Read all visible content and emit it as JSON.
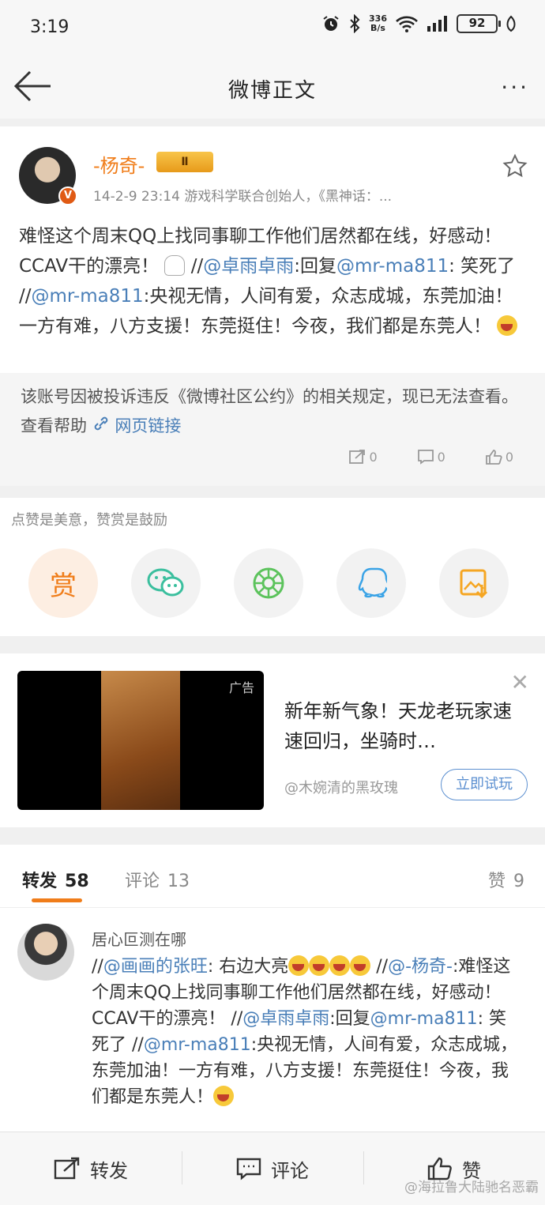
{
  "status_bar": {
    "time": "3:19",
    "net_speed_value": "336",
    "net_speed_unit": "B/s",
    "battery": "92"
  },
  "nav": {
    "title": "微博正文",
    "more": "···"
  },
  "post": {
    "username": "-杨奇-",
    "badge_level": "Ⅱ",
    "verified": "V",
    "time": "14-2-9 23:14",
    "source": "游戏科学联合创始人，《黑神话：...",
    "text_1": "难怪这个周末QQ上找同事聊工作他们居然都在线，好感动！CCAV干的漂亮！",
    "slash_1": " //",
    "mention_1": "@卓雨卓雨",
    "text_2": ":回复",
    "mention_2": "@mr-ma811",
    "text_3": ": 笑死了 //",
    "mention_3": "@mr-ma811",
    "text_4": ":央视无情，人间有爱，众志成城，东莞加油！一方有难，八方支援！东莞挺住！今夜，我们都是东莞人！"
  },
  "reposted": {
    "text": "该账号因被投诉违反《微博社区公约》的相关规定，现已无法查看。查看帮助",
    "link": "网页链接",
    "repost_count": "0",
    "comment_count": "0",
    "like_count": "0"
  },
  "reward": {
    "tip": "点赞是美意，赞赏是鼓励",
    "reward_label": "赏"
  },
  "ad": {
    "tag": "广告",
    "title": "新年新气象！天龙老玩家速速回归，坐骑时…",
    "source": "@木婉清的黑玫瑰",
    "cta": "立即试玩",
    "close": "✕"
  },
  "tabs": {
    "repost_label": "转发",
    "repost_count": "58",
    "comment_label": "评论",
    "comment_count": "13",
    "like_label": "赞",
    "like_count": "9"
  },
  "repost_item": {
    "name": "居心叵测在哪",
    "slash_1": "//",
    "mention_1": "@画画的张旺",
    "text_1": ": 右边大亮",
    "slash_2": " //",
    "mention_2": "@-杨奇-",
    "text_2": ":难怪这个周末QQ上找同事聊工作他们居然都在线，好感动！CCAV干的漂亮！ //",
    "mention_3": "@卓雨卓雨",
    "text_3": ":回复",
    "mention_4": "@mr-ma811",
    "text_4": ": 笑死了 //",
    "mention_5": "@mr-ma811",
    "text_5": ":央视无情，人间有爱，众志成城，东莞加油！一方有难，八方支援！东莞挺住！今夜，我们都是东莞人！"
  },
  "bottom_bar": {
    "repost": "转发",
    "comment": "评论",
    "like": "赞"
  },
  "watermark": "@海拉鲁大陆驰名恶霸",
  "colors": {
    "accent": "#f07d1a",
    "link": "#4a7fb8"
  },
  "icons": [
    "back-arrow-icon",
    "more-icon",
    "star-icon",
    "verified-icon",
    "link-icon",
    "repost-icon",
    "comment-icon",
    "like-icon",
    "wechat-icon",
    "moments-icon",
    "qq-icon",
    "save-image-icon",
    "close-icon"
  ]
}
